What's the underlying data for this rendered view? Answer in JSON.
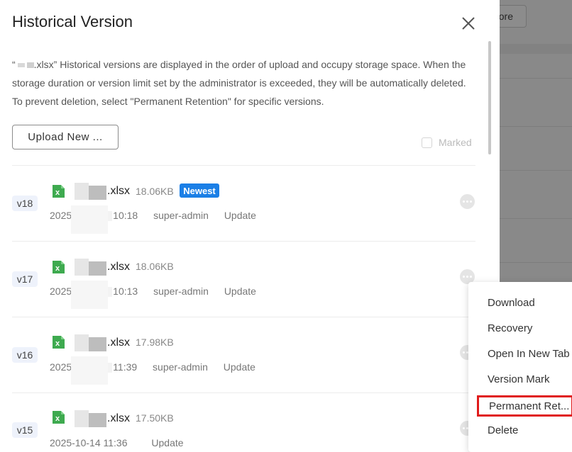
{
  "background": {
    "more_button_label": "ore"
  },
  "drawer": {
    "title": "Historical Version",
    "description_prefix": "“",
    "description_file": ".xlsx”",
    "description_text": " Historical versions are displayed in the order of upload and occupy storage space. When the storage duration or version limit set by the administrator is exceeded, they will be automatically deleted. To prevent deletion, select \"Permanent Retention\" for specific versions.",
    "upload_button": "Upload New ...",
    "marked_label": "Marked",
    "icons": {
      "close": "close-icon",
      "file": "excel-file-icon",
      "more": "more-dots-icon"
    },
    "accent_color": "#1b7fe6"
  },
  "versions": [
    {
      "version": "v18",
      "file_ext": ".xlsx",
      "size": "18.06KB",
      "badge": "Newest",
      "date_prefix": "2025",
      "time": "10:18",
      "user": "super-admin",
      "action": "Update"
    },
    {
      "version": "v17",
      "file_ext": ".xlsx",
      "size": "18.06KB",
      "badge": "",
      "date_prefix": "2025",
      "time": "10:13",
      "user": "super-admin",
      "action": "Update"
    },
    {
      "version": "v16",
      "file_ext": ".xlsx",
      "size": "17.98KB",
      "badge": "",
      "date_prefix": "2025",
      "time": "11:39",
      "user": "super-admin",
      "action": "Update"
    },
    {
      "version": "v15",
      "file_ext": ".xlsx",
      "size": "17.50KB",
      "badge": "",
      "date_full": "2025-10-14 11:36",
      "user": "",
      "action": "Update"
    }
  ],
  "context_menu": {
    "items": [
      "Download",
      "Recovery",
      "Open In New Tab",
      "Version Mark",
      "Permanent Ret...",
      "Delete"
    ],
    "highlight_color": "#e01b1b"
  }
}
